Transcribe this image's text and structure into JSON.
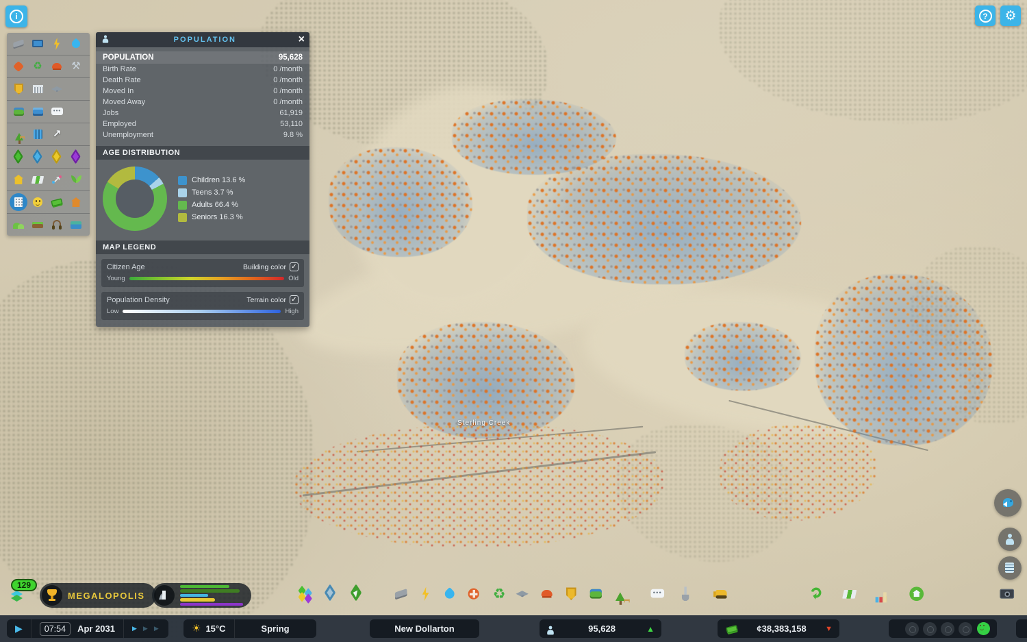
{
  "top_bar": {
    "info_button_glyph": "i",
    "help_button_glyph": "?",
    "settings_icon": "gear"
  },
  "infoview_grid": {
    "rows": [
      [
        "roads-icon",
        "electronics-icon",
        "electricity-icon",
        "water-icon"
      ],
      [
        "healthcare-icon",
        "garbage-icon",
        "fire-icon",
        "maintenance-icon"
      ],
      [
        "police-icon",
        "administration-icon",
        "education-icon"
      ],
      [
        "transportation-icon",
        "post-icon",
        "telecom-icon"
      ],
      [
        "parks-icon",
        "levels-icon",
        "routes-icon"
      ],
      [
        "residential-zone-icon",
        "commercial-zone-icon",
        "industrial-zone-icon",
        "office-zone-icon"
      ],
      [
        "land-value-icon",
        "tourism-icon",
        "economy-chart-icon",
        "resources-icon"
      ],
      [
        "population-icon",
        "happiness-icon",
        "money-icon",
        "landmarks-icon"
      ],
      [
        "terrain-icon",
        "fertility-icon",
        "noise-icon",
        "water-pollution-icon"
      ]
    ],
    "selected": "population-icon"
  },
  "population_panel": {
    "title": "POPULATION",
    "close_glyph": "×",
    "stats": [
      {
        "label": "POPULATION",
        "value": "95,628"
      },
      {
        "label": "Birth Rate",
        "value": "0 /month"
      },
      {
        "label": "Death Rate",
        "value": "0 /month"
      },
      {
        "label": "Moved In",
        "value": "0 /month"
      },
      {
        "label": "Moved Away",
        "value": "0 /month"
      },
      {
        "label": "Jobs",
        "value": "61,919"
      },
      {
        "label": "Employed",
        "value": "53,110"
      },
      {
        "label": "Unemployment",
        "value": "9.8 %"
      }
    ],
    "age_distribution": {
      "title": "AGE DISTRIBUTION",
      "type": "donut",
      "segments": [
        {
          "label": "Children",
          "percent": 13.6,
          "display": "13.6 %",
          "color": "#3d93cd"
        },
        {
          "label": "Teens",
          "percent": 3.7,
          "display": "3.7 %",
          "color": "#a9d3ea"
        },
        {
          "label": "Adults",
          "percent": 66.4,
          "display": "66.4 %",
          "color": "#64b94e"
        },
        {
          "label": "Seniors",
          "percent": 16.3,
          "display": "16.3 %",
          "color": "#b2ba3f"
        }
      ]
    },
    "map_legend": {
      "title": "MAP LEGEND",
      "citizen_age": {
        "label": "Citizen Age",
        "toggle_label": "Building color",
        "checked": true,
        "check_glyph": "✓",
        "min": "Young",
        "max": "Old"
      },
      "population_density": {
        "label": "Population Density",
        "toggle_label": "Terrain color",
        "checked": true,
        "check_glyph": "✓",
        "min": "Low",
        "max": "High"
      }
    }
  },
  "progression": {
    "xp_level": "129",
    "milestone_label": "MEGALOPOLIS",
    "demand_bars": [
      {
        "name": "demand-green",
        "color": "#4db835",
        "value": 78
      },
      {
        "name": "demand-dark-green",
        "color": "#3f7d22",
        "value": 95
      },
      {
        "name": "demand-blue",
        "color": "#45b5e0",
        "value": 45
      },
      {
        "name": "demand-yellow",
        "color": "#e8c832",
        "value": 55
      },
      {
        "name": "demand-purple",
        "color": "#8c35c8",
        "value": 100
      }
    ]
  },
  "toolbar": {
    "icons": [
      "zones",
      "areas",
      "landscaping",
      "roads",
      "electricity",
      "water-sewage",
      "healthcare",
      "garbage",
      "education",
      "fire-rescue",
      "police",
      "transportation",
      "parks-recreation",
      "communications",
      "terraforming",
      "bulldozer",
      "economy",
      "progression-map",
      "statistics",
      "map-tiles",
      "photo-mode"
    ]
  },
  "side_buttons": [
    "chirper-button",
    "citizen-lifepath-button",
    "journal-button"
  ],
  "status_bar": {
    "time": "07:54",
    "date": "Apr 2031",
    "speed_glyphs": "▶▶▶",
    "play_glyph": "▶",
    "temperature": "15°C",
    "season": "Spring",
    "city_name": "New Dollarton",
    "population": "95,628",
    "money": "¢38,383,158",
    "population_trend": "up",
    "money_trend": "down"
  },
  "map": {
    "labels": [
      {
        "text": "Sterling Creek"
      }
    ]
  },
  "colors": {
    "accent_blue": "#3cb4e8",
    "panel_bg": "#50575e",
    "milestone_yellow": "#e8c83c",
    "xp_green": "#3fd42e",
    "money_up_green": "#3ed444",
    "money_down_red": "#e04428"
  }
}
